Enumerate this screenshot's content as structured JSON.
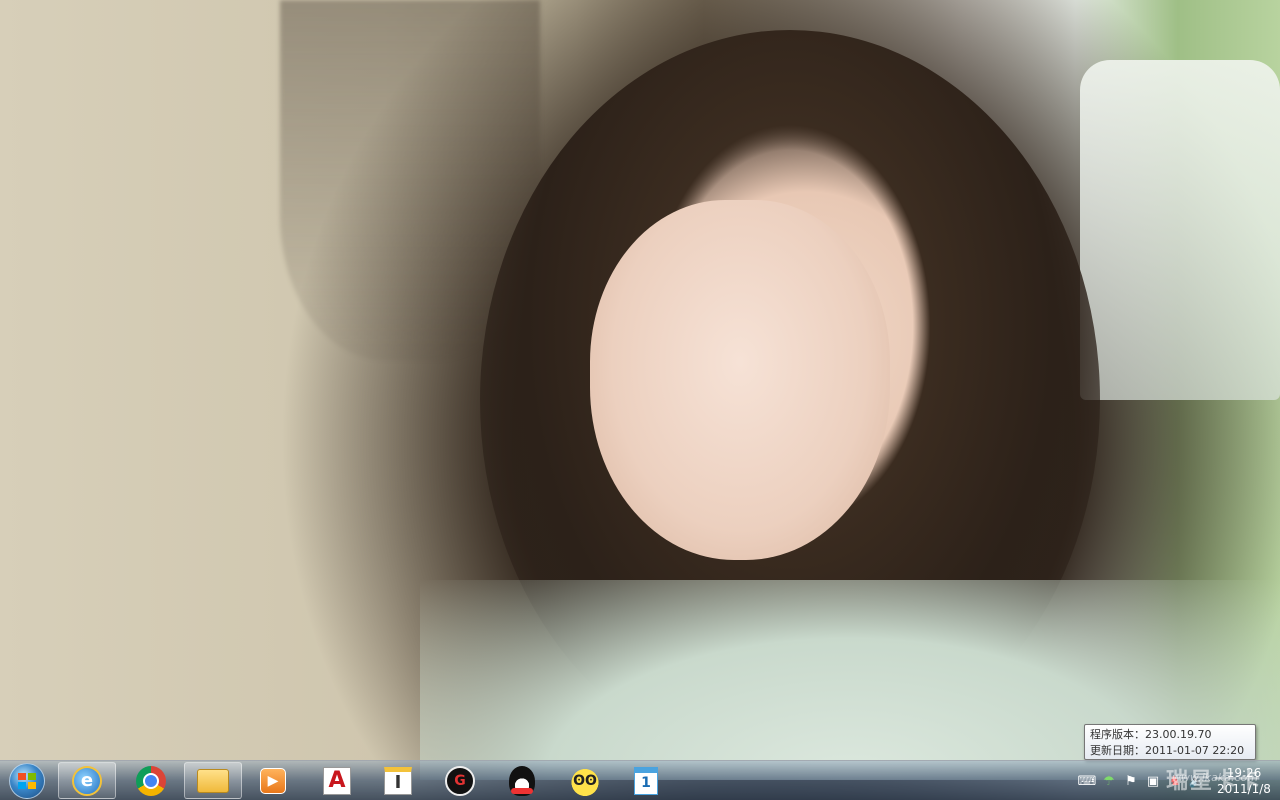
{
  "tooltip": {
    "version_label": "程序版本：",
    "version_value": "23.00.19.70",
    "date_label": "更新日期：",
    "date_value": "2011-01-07 22:20"
  },
  "taskbar": {
    "pinned": [
      {
        "id": "ie",
        "icon": "internet-explorer-icon",
        "glyph": "e",
        "active": true
      },
      {
        "id": "chrome",
        "icon": "chrome-icon",
        "glyph": "",
        "active": false
      },
      {
        "id": "explorer",
        "icon": "folder-icon",
        "glyph": "",
        "active": true
      },
      {
        "id": "media",
        "icon": "media-player-icon",
        "glyph": "▶",
        "active": false
      },
      {
        "id": "autocad",
        "icon": "autocad-icon",
        "glyph": "A",
        "active": false
      },
      {
        "id": "pro",
        "icon": "pro-app-icon",
        "glyph": "I",
        "active": false
      },
      {
        "id": "game",
        "icon": "game-icon",
        "glyph": "G",
        "active": false
      },
      {
        "id": "qq",
        "icon": "qq-penguin-icon",
        "glyph": "",
        "active": false
      },
      {
        "id": "mascot",
        "icon": "mascot-icon",
        "glyph": "ʘʘ",
        "active": false
      },
      {
        "id": "calendar",
        "icon": "calendar-icon",
        "glyph": "1",
        "active": false
      }
    ]
  },
  "tray": {
    "icons": [
      "keyboard-icon",
      "umbrella-icon",
      "flag-icon",
      "network-icon",
      "antivirus-icon",
      "volume-icon"
    ],
    "time": "19:26",
    "date": "2011/1/8"
  },
  "watermark": {
    "brand": "瑞星卡卡",
    "url": "www.ikaka.com"
  }
}
